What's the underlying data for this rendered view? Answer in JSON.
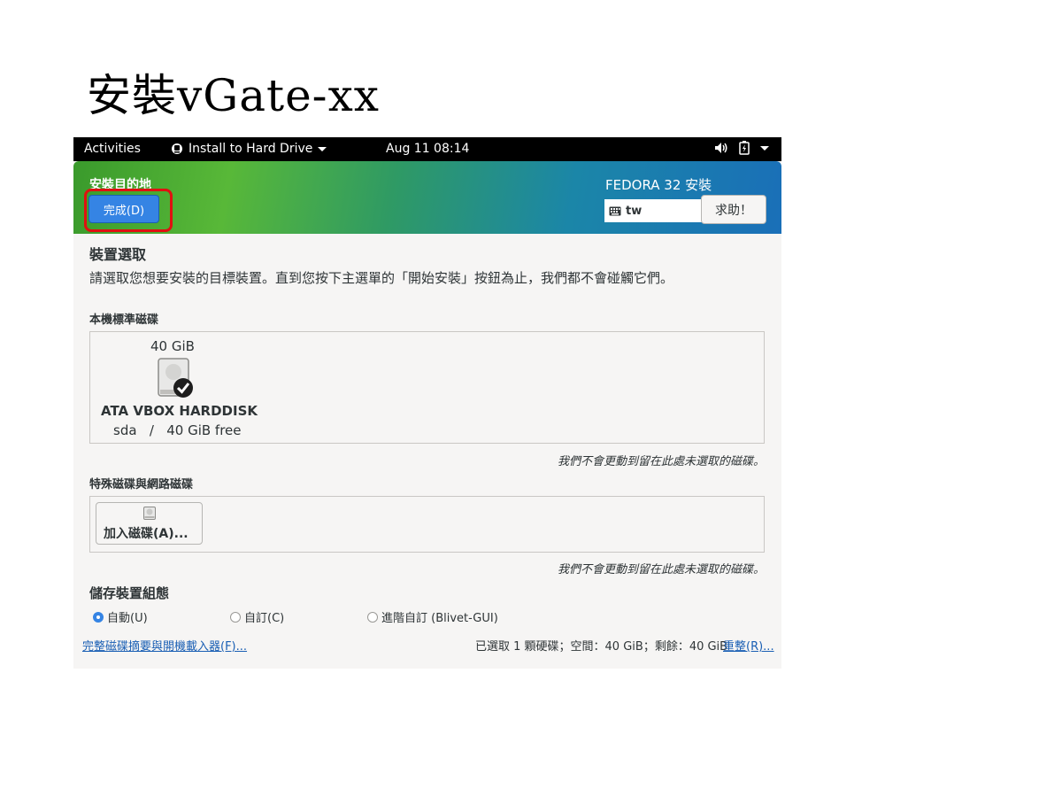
{
  "slide": {
    "title": "安裝vGate-xx"
  },
  "topbar": {
    "activities": "Activities",
    "app_menu": "Install to Hard Drive",
    "clock": "Aug 11  08:14",
    "icons": [
      "app-icon",
      "volume-icon",
      "battery-icon",
      "chevron-down-icon"
    ]
  },
  "header": {
    "title": "安裝目的地",
    "done_button": "完成(D)",
    "product": "FEDORA 32 安裝",
    "keyboard_layout": "tw",
    "help_button": "求助！"
  },
  "device_selection": {
    "heading": "裝置選取",
    "description": "請選取您想要安裝的目標裝置。直到您按下主選單的「開始安裝」按鈕為止，我們都不會碰觸它們。",
    "local_disks": {
      "heading": "本機標準磁碟",
      "disks": [
        {
          "size": "40 GiB",
          "name": "ATA VBOX HARDDISK",
          "device": "sda",
          "separator": "/",
          "free": "40 GiB free",
          "selected": true
        }
      ],
      "note": "我們不會更動到留在此處未選取的磁碟。"
    },
    "special_disks": {
      "heading": "特殊磁碟與網路磁碟",
      "add_button": "加入磁碟(A)...",
      "note": "我們不會更動到留在此處未選取的磁碟。"
    }
  },
  "storage_config": {
    "heading": "儲存裝置組態",
    "options": [
      {
        "label": "自動(U)",
        "selected": true
      },
      {
        "label": "自訂(C)",
        "selected": false
      },
      {
        "label": "進階自訂 (Blivet-GUI)",
        "selected": false
      }
    ]
  },
  "footer": {
    "summary_link": "完整磁碟摘要與開機載入器(F)...",
    "summary": "已選取 1 顆硬碟；空間：40 GiB；剩餘：40 GiB",
    "reset_link": "重整(R)..."
  },
  "colors": {
    "accent": "#3584e4",
    "highlight": "#e01010",
    "link": "#1a5fb4"
  }
}
